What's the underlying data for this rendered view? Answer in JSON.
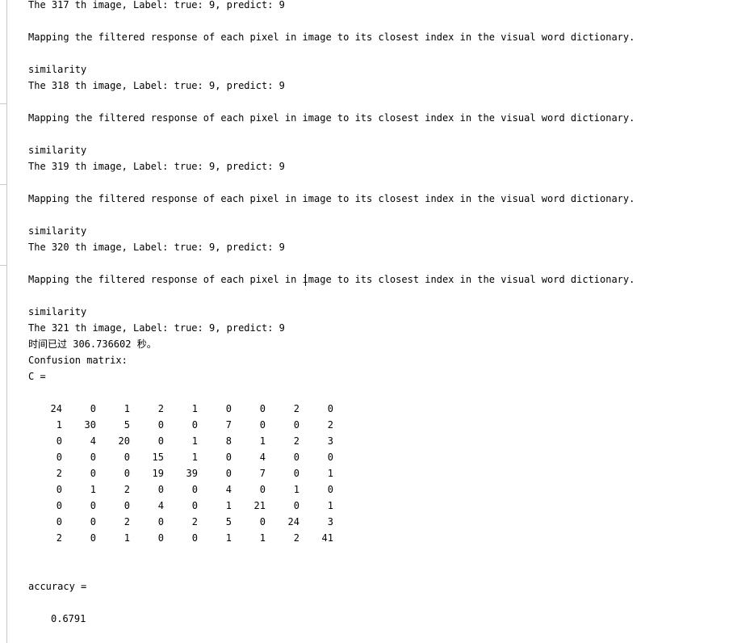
{
  "console": {
    "blocks": [
      {
        "header": "The 317 th image, Label: true: 9, predict: 9"
      },
      {
        "mapping": "Mapping the filtered response of each pixel in image to its closest index in the visual word dictionary.",
        "similarity": "similarity",
        "header": "The 318 th image, Label: true: 9, predict: 9"
      },
      {
        "mapping": "Mapping the filtered response of each pixel in image to its closest index in the visual word dictionary.",
        "similarity": "similarity",
        "header": "The 319 th image, Label: true: 9, predict: 9"
      },
      {
        "mapping": "Mapping the filtered response of each pixel in image to its closest index in the visual word dictionary.",
        "similarity": "similarity",
        "header": "The 320 th image, Label: true: 9, predict: 9"
      },
      {
        "mapping": "Mapping the filtered response of each pixel in image to its closest index in the visual word dictionary.",
        "similarity": "similarity",
        "header": "The 321 th image, Label: true: 9, predict: 9"
      }
    ],
    "elapsed": "时间已过 306.736602 秒。",
    "confusion_label": "Confusion matrix:",
    "c_assign": "C =",
    "matrix": [
      [
        24,
        0,
        1,
        2,
        1,
        0,
        0,
        2,
        0
      ],
      [
        1,
        30,
        5,
        0,
        0,
        7,
        0,
        0,
        2
      ],
      [
        0,
        4,
        20,
        0,
        1,
        8,
        1,
        2,
        3
      ],
      [
        0,
        0,
        0,
        15,
        1,
        0,
        4,
        0,
        0
      ],
      [
        2,
        0,
        0,
        19,
        39,
        0,
        7,
        0,
        1
      ],
      [
        0,
        1,
        2,
        0,
        0,
        4,
        0,
        1,
        0
      ],
      [
        0,
        0,
        0,
        4,
        0,
        1,
        21,
        0,
        1
      ],
      [
        0,
        0,
        2,
        0,
        2,
        5,
        0,
        24,
        3
      ],
      [
        2,
        0,
        1,
        0,
        0,
        1,
        1,
        2,
        41
      ]
    ],
    "accuracy_label": "accuracy =",
    "accuracy_value": "0.6791"
  }
}
